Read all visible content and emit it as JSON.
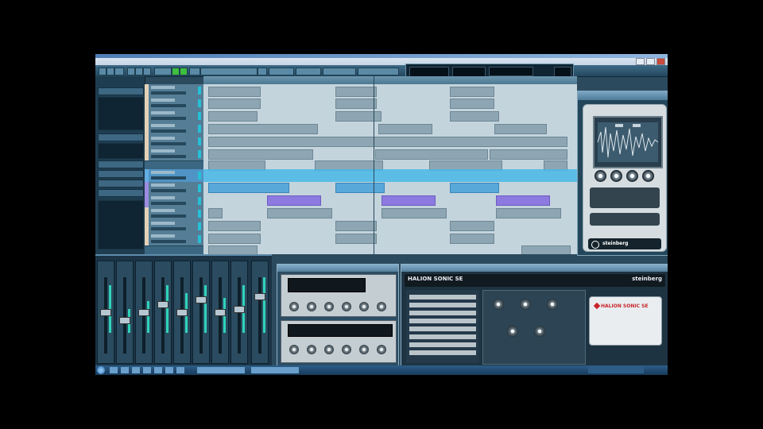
{
  "window": {
    "title": ""
  },
  "menus": [
    "",
    "",
    "",
    "",
    "",
    "",
    "",
    "",
    "",
    "",
    "",
    ""
  ],
  "plugins": {
    "sampler_brand": "steinberg",
    "halion_name": "HALION SONIC SE",
    "halion_brand": "steinberg",
    "halion_badge": "HALION SONIC SE"
  },
  "colors": {
    "accent_blue": "#49b8e8",
    "midi_part": "#8c7ae0",
    "audio_part": "#8ea6b3",
    "play_green": "#31c741"
  },
  "icons": [
    "minimize-icon",
    "maximize-icon",
    "close-icon",
    "play-icon",
    "record-icon",
    "start-orb-icon"
  ]
}
